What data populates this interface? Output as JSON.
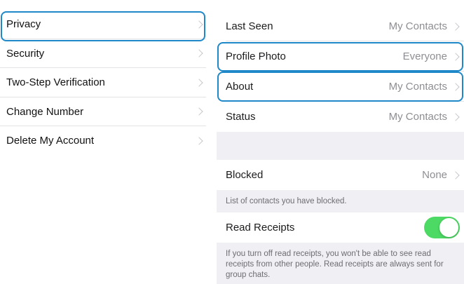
{
  "left_menu": {
    "items": [
      {
        "label": "Privacy"
      },
      {
        "label": "Security"
      },
      {
        "label": "Two-Step Verification"
      },
      {
        "label": "Change Number"
      },
      {
        "label": "Delete My Account"
      }
    ]
  },
  "privacy": {
    "last_seen": {
      "label": "Last Seen",
      "value": "My Contacts"
    },
    "profile_photo": {
      "label": "Profile Photo",
      "value": "Everyone"
    },
    "about": {
      "label": "About",
      "value": "My Contacts"
    },
    "status": {
      "label": "Status",
      "value": "My Contacts"
    },
    "blocked": {
      "label": "Blocked",
      "value": "None"
    },
    "blocked_note": "List of contacts you have blocked.",
    "read_receipts": {
      "label": "Read Receipts",
      "enabled": true
    },
    "read_receipts_note": "If you turn off read receipts, you won't be able to see read receipts from other people. Read receipts are always sent for group chats."
  },
  "colors": {
    "highlight": "#1e88c8",
    "toggle_on": "#4cd964",
    "secondary_text": "#8e8e93",
    "grouped_bg": "#efeff4"
  }
}
